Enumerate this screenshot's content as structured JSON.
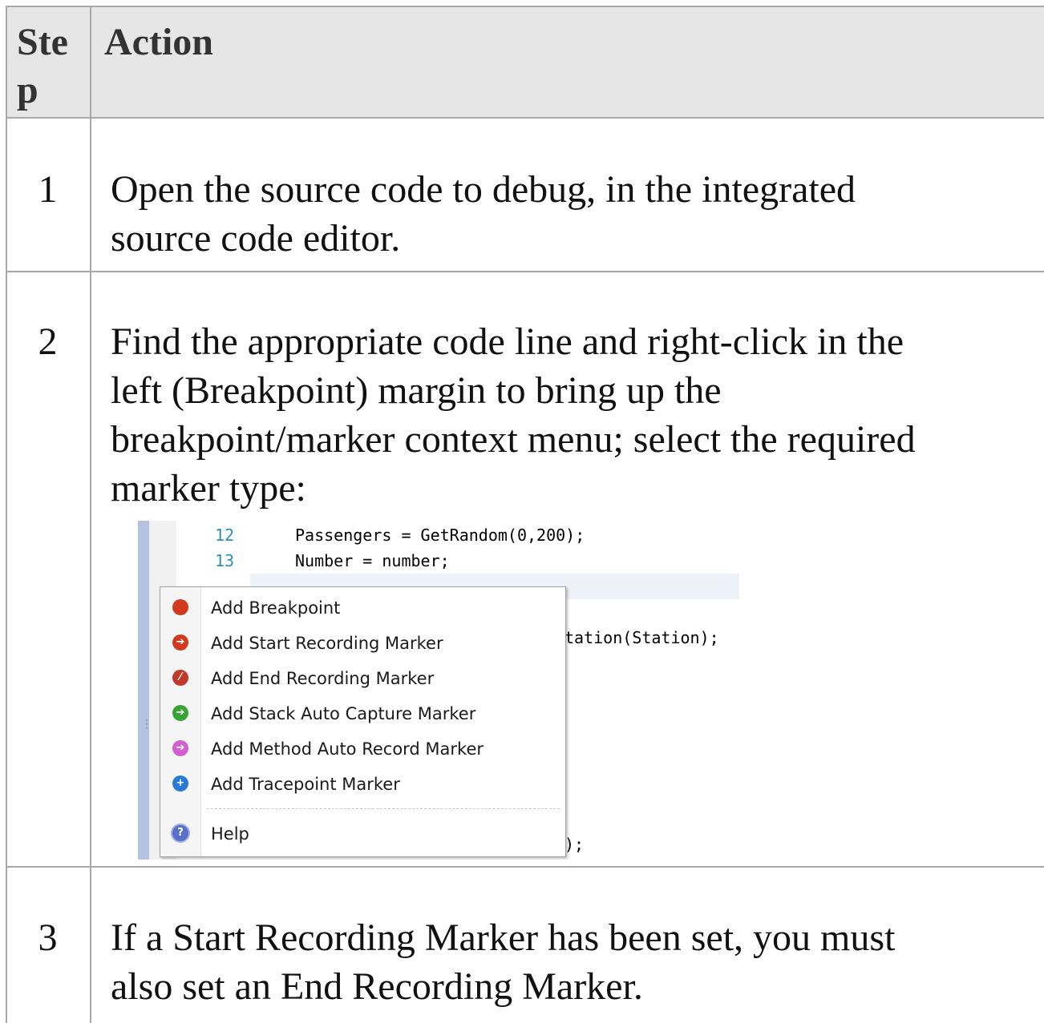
{
  "table": {
    "header": {
      "step": "Ste p",
      "action": "Action"
    },
    "rows": [
      {
        "step": "1",
        "lines": [
          "Open the source code to debug, in the integrated",
          "source code editor."
        ]
      },
      {
        "step": "2",
        "lines": [
          "Find the appropriate code line and right-click in the",
          "left (Breakpoint) margin to bring up the",
          "breakpoint/marker context menu; select the required",
          "marker type:"
        ]
      },
      {
        "step": "3",
        "lines": [
          "If a Start Recording Marker has been set, you must",
          "also set an End Recording Marker."
        ]
      }
    ]
  },
  "screenshot": {
    "code_lines": [
      {
        "number": "12",
        "text": "Passengers = GetRandom(0,200);"
      },
      {
        "number": "13",
        "text": "Number = number;"
      }
    ],
    "code_fragments": [
      "tation(Station);",
      ");"
    ],
    "context_menu": {
      "items": [
        {
          "label": "Add Breakpoint",
          "icon": "breakpoint-icon",
          "color": "#d23a1f",
          "glyph": ""
        },
        {
          "label": "Add Start Recording Marker",
          "icon": "start-recording-icon",
          "color": "#d23a1f",
          "glyph": "➔"
        },
        {
          "label": "Add End Recording Marker",
          "icon": "end-recording-icon",
          "color": "#c0392b",
          "glyph": "⁄"
        },
        {
          "label": "Add Stack Auto Capture Marker",
          "icon": "stack-capture-icon",
          "color": "#3aa335",
          "glyph": "➔"
        },
        {
          "label": "Add Method Auto Record Marker",
          "icon": "method-record-icon",
          "color": "#d25fd0",
          "glyph": "➔"
        },
        {
          "label": "Add Tracepoint Marker",
          "icon": "tracepoint-icon",
          "color": "#2a78d8",
          "glyph": "+"
        }
      ],
      "help": {
        "label": "Help",
        "icon": "help-icon",
        "color": "#5a6fc8",
        "glyph": "?"
      }
    }
  }
}
